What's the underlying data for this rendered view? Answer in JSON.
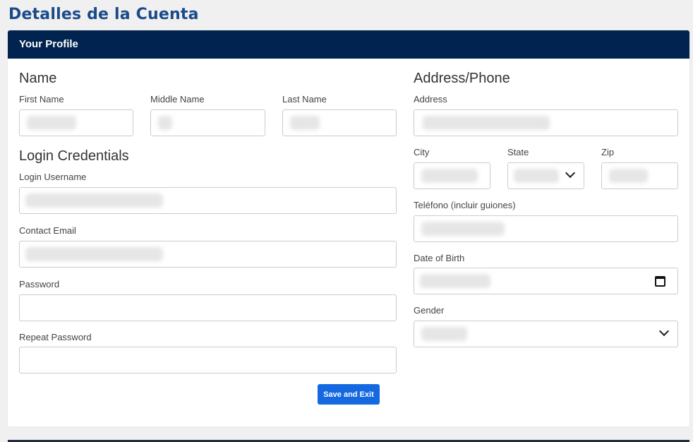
{
  "page": {
    "title": "Detalles de la Cuenta"
  },
  "card": {
    "header": "Your Profile"
  },
  "name_section": {
    "title": "Name",
    "first_name_label": "First Name",
    "middle_name_label": "Middle Name",
    "last_name_label": "Last Name"
  },
  "login_section": {
    "title": "Login Credentials",
    "username_label": "Login Username",
    "email_label": "Contact Email",
    "password_label": "Password",
    "repeat_password_label": "Repeat Password"
  },
  "address_section": {
    "title": "Address/Phone",
    "address_label": "Address",
    "city_label": "City",
    "state_label": "State",
    "zip_label": "Zip",
    "phone_label": "Teléfono (incluir guiones)",
    "dob_label": "Date of Birth",
    "gender_label": "Gender"
  },
  "actions": {
    "save_label": "Save and Exit"
  },
  "icons": {
    "select": "chevron-down-icon",
    "date": "calendar-icon"
  },
  "colors": {
    "title": "#1b4a8a",
    "header_bg": "#00234f",
    "button": "#1469e0"
  }
}
